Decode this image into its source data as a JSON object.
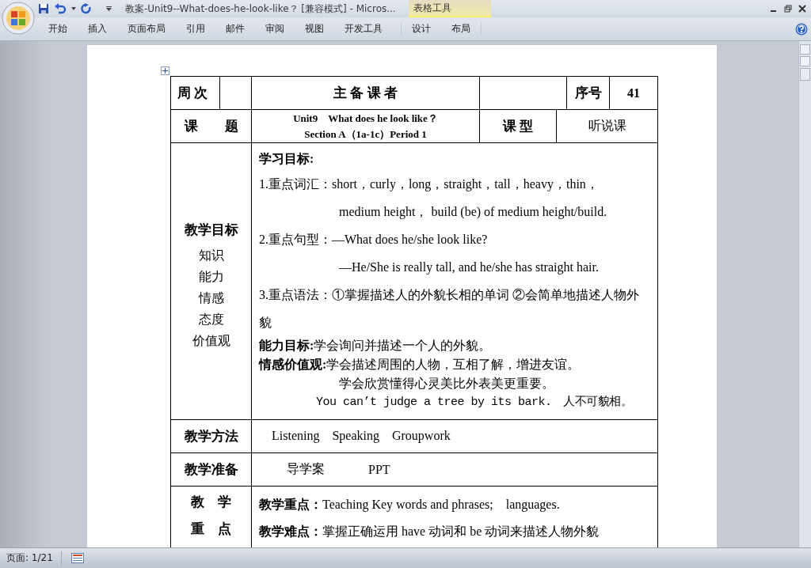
{
  "window": {
    "title": "教案-Unit9--What-does-he-look-like？ [兼容模式] - Micros...",
    "contextual_group": "表格工具"
  },
  "ribbon_tabs": [
    "开始",
    "插入",
    "页面布局",
    "引用",
    "邮件",
    "审阅",
    "视图",
    "开发工具"
  ],
  "contextual_tabs": [
    "设计",
    "布局"
  ],
  "lesson_table": {
    "week_label": "周 次",
    "preparer_label": "主 备 课 者",
    "number_label": "序号",
    "number": "41",
    "topic_label": "课　　题",
    "topic_lines": [
      "Unit9　What does he look like？",
      "Section A（1a-1c）Period 1"
    ],
    "type_label": "课 型",
    "type": "听说课",
    "objectives_label": "教学目标",
    "objectives_sublabels": [
      "知识",
      "能力",
      "情感",
      "态度",
      "价值观"
    ],
    "objectives": [
      {
        "kind": "heading",
        "text": "学习目标:"
      },
      {
        "kind": "item",
        "text": "1.重点词汇：short，curly，long，straight，tall，heavy，thin，"
      },
      {
        "kind": "indent",
        "text": "medium height， build (be) of medium height/build."
      },
      {
        "kind": "item",
        "text": "2.重点句型：—What does he/she look like?"
      },
      {
        "kind": "indent",
        "text": "—He/She is really tall, and he/she has straight hair."
      },
      {
        "kind": "item",
        "text": "3.重点语法：①掌握描述人的外貌长相的单词 ②会简单地描述人物外貌"
      },
      {
        "kind": "goal",
        "text": "**能力目标:**学会询问并描述一个人的外貌。"
      },
      {
        "kind": "goal",
        "text": "**情感价值观:**学会描述周围的人物，互相了解，增进友谊。"
      },
      {
        "kind": "goal-indent",
        "text": "学会欣赏懂得心灵美比外表美更重要。"
      },
      {
        "kind": "proverb",
        "text": "You can’t judge a tree by its bark.　人不可貌相。"
      }
    ],
    "methods_label": "教学方法",
    "methods": "Listening　Speaking　Groupwork",
    "preparation_label": "教学准备",
    "preparation": [
      "导学案",
      "PPT"
    ],
    "focus_label_lines": [
      "教　学",
      "重　点"
    ],
    "focus": [
      "**教学重点：**Teaching Key words and phrases;　languages.",
      "**教学难点：**掌握正确运用 have 动词和 be 动词来描述人物外貌"
    ]
  },
  "status_bar": {
    "page": "页面: 1/21"
  }
}
